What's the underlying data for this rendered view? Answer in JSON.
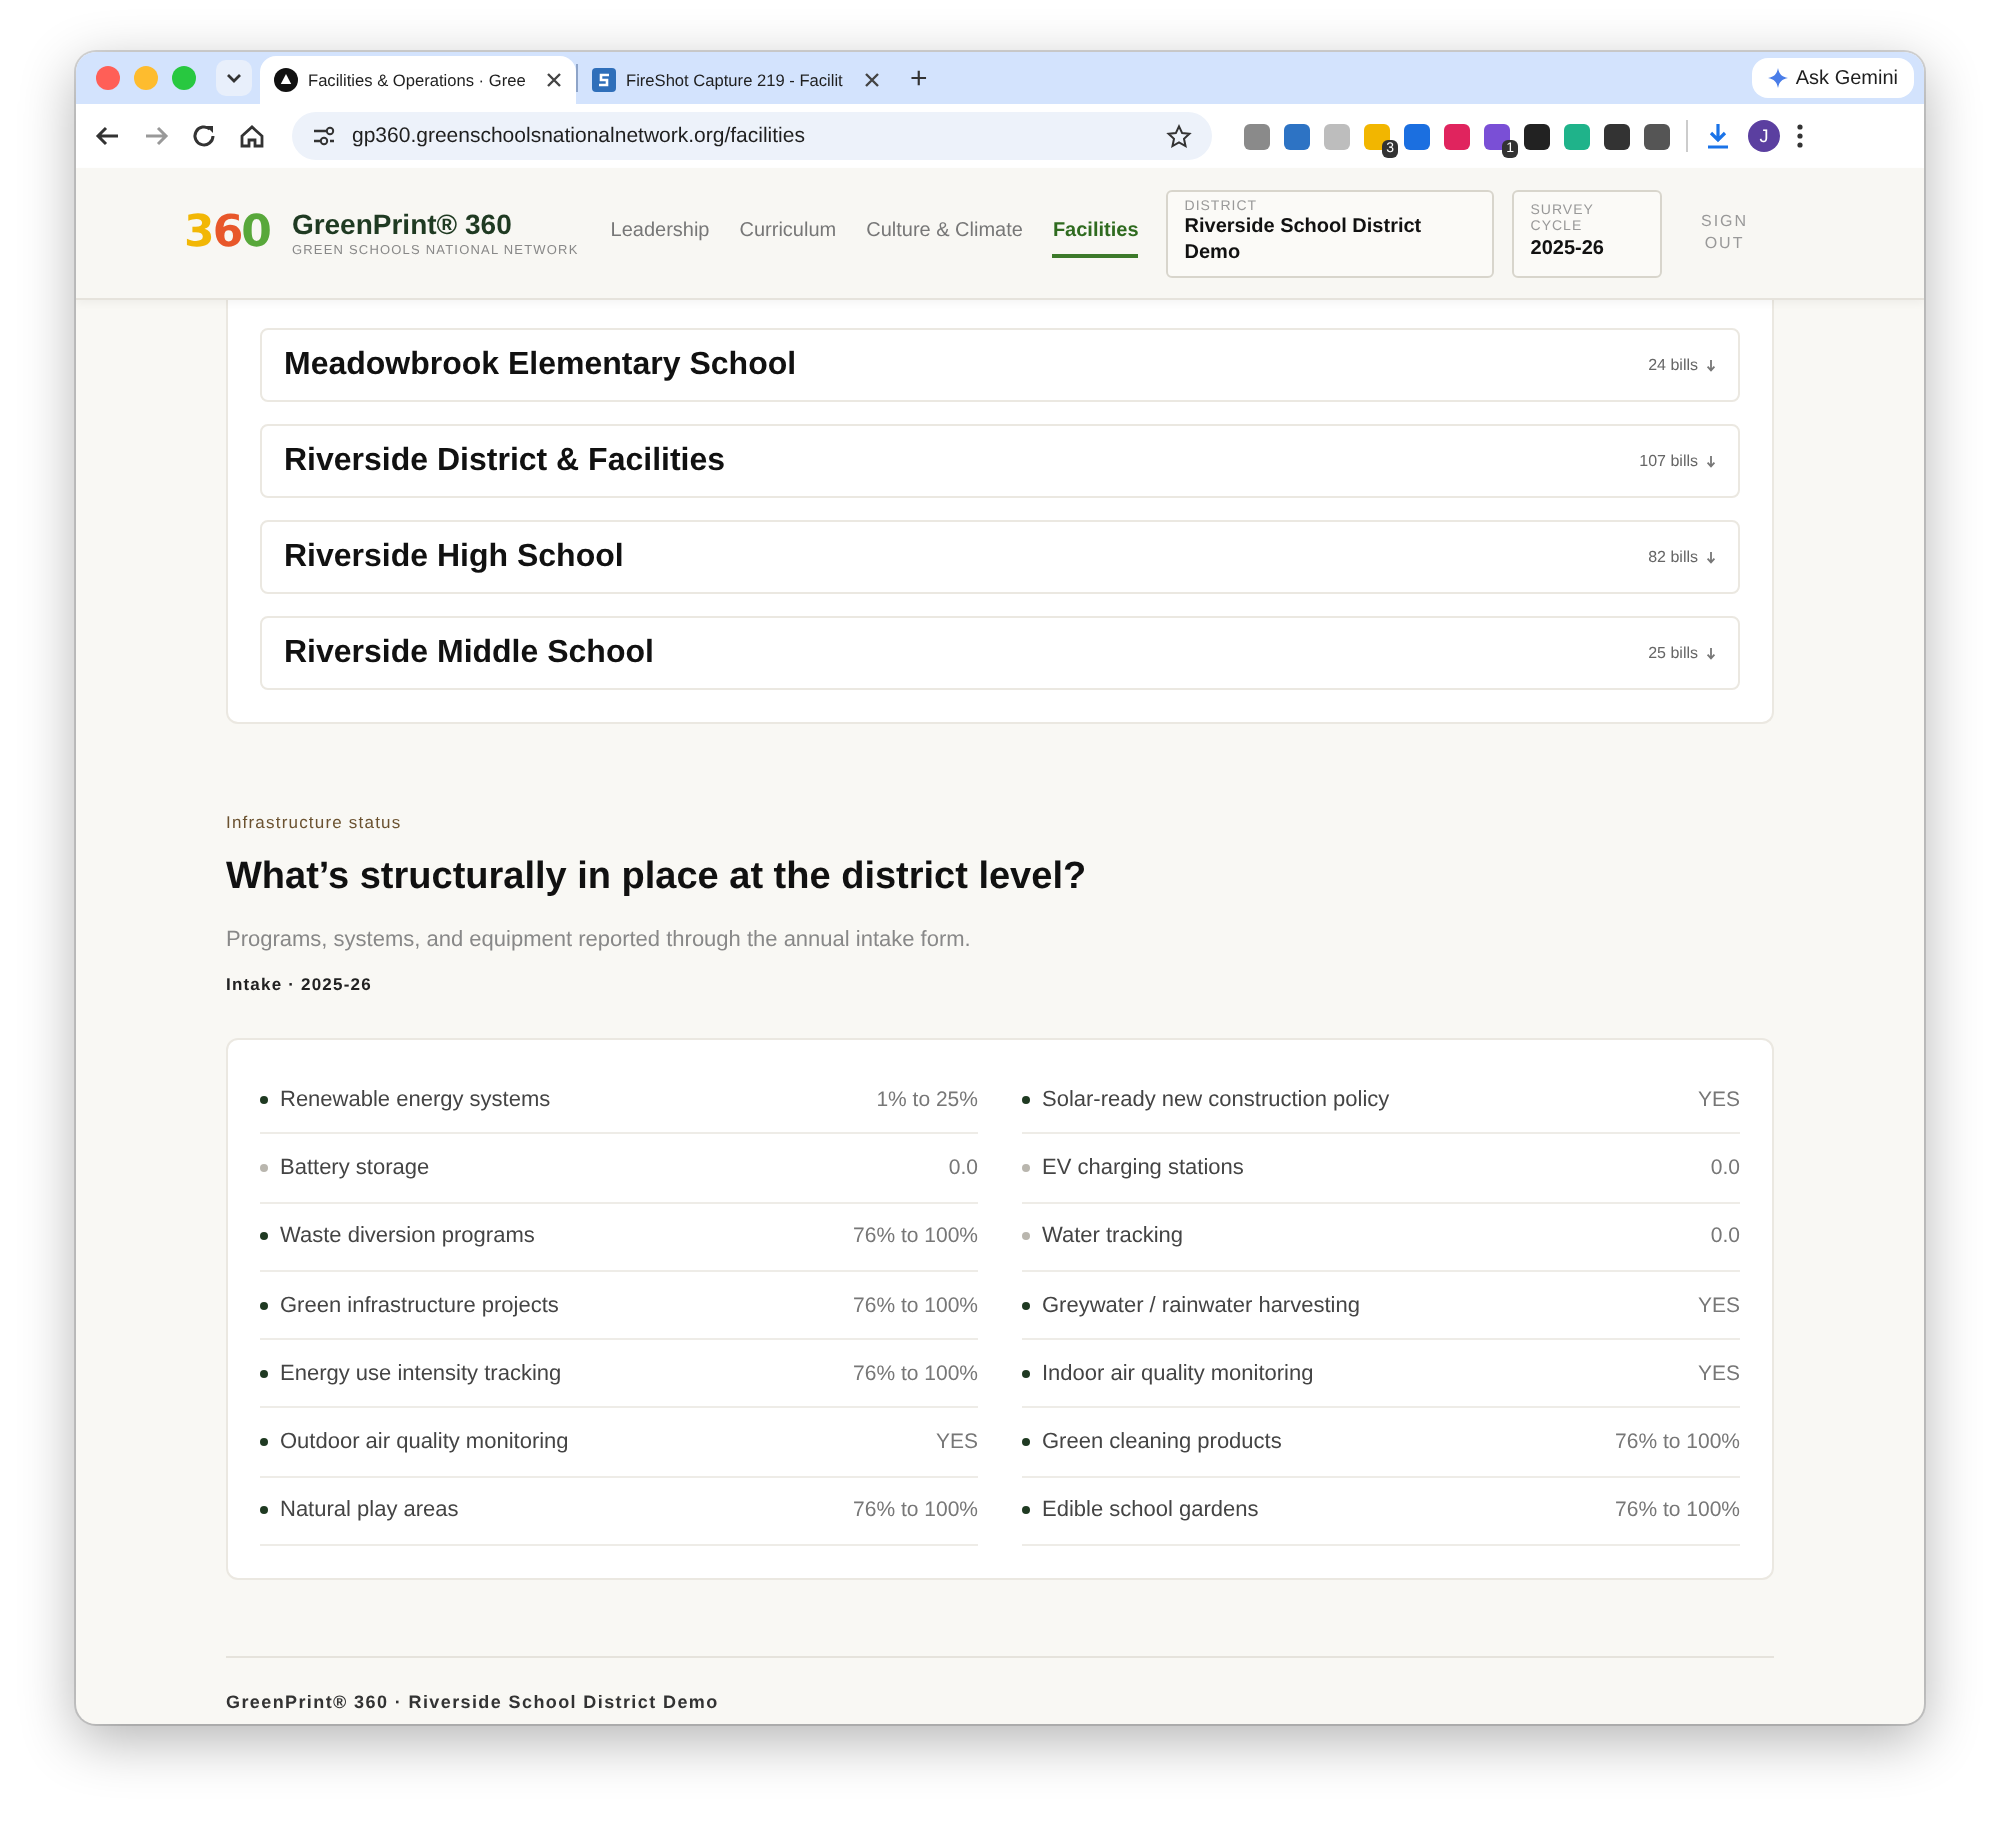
{
  "browser": {
    "tabs": [
      {
        "title": "Facilities & Operations · Gree",
        "selected": true
      },
      {
        "title": "FireShot Capture 219 - Facilit",
        "selected": false
      }
    ],
    "new_tab": "+",
    "url": "gp360.greenschoolsnationalnetwork.org/facilities",
    "ask_gemini": "Ask Gemini",
    "extension_badges": [
      "3",
      "1"
    ],
    "profile_initial": "J"
  },
  "header": {
    "logo_text": "360",
    "brand": "GreenPrint® 360",
    "tagline": "GREEN SCHOOLS NATIONAL NETWORK",
    "nav": [
      {
        "label": "Leadership",
        "selected": false
      },
      {
        "label": "Curriculum",
        "selected": false
      },
      {
        "label": "Culture & Climate",
        "selected": false
      },
      {
        "label": "Facilities",
        "selected": true
      }
    ],
    "district": {
      "label": "DISTRICT",
      "value": "Riverside School District Demo"
    },
    "cycle": {
      "label": "SURVEY CYCLE",
      "value": "2025-26"
    },
    "sign_out": "SIGN OUT"
  },
  "schools": [
    {
      "name": "Meadowbrook Elementary School",
      "bills": "24 bills"
    },
    {
      "name": "Riverside District & Facilities",
      "bills": "107 bills"
    },
    {
      "name": "Riverside High School",
      "bills": "82 bills"
    },
    {
      "name": "Riverside Middle School",
      "bills": "25 bills"
    }
  ],
  "infrastructure": {
    "eyebrow": "Infrastructure status",
    "title": "What’s structurally in place at the district level?",
    "subtitle": "Programs, systems, and equipment reported through the annual intake form.",
    "meta": "Intake · 2025-26",
    "columns": [
      {
        "items": [
          {
            "label": "Renewable energy systems",
            "value": "1% to 25%",
            "active": true
          },
          {
            "label": "Battery storage",
            "value": "0.0",
            "active": false
          },
          {
            "label": "Waste diversion programs",
            "value": "76% to 100%",
            "active": true
          },
          {
            "label": "Green infrastructure projects",
            "value": "76% to 100%",
            "active": true
          },
          {
            "label": "Energy use intensity tracking",
            "value": "76% to 100%",
            "active": true
          },
          {
            "label": "Outdoor air quality monitoring",
            "value": "YES",
            "active": true
          },
          {
            "label": "Natural play areas",
            "value": "76% to 100%",
            "active": true
          }
        ]
      },
      {
        "items": [
          {
            "label": "Solar-ready new construction policy",
            "value": "YES",
            "active": true
          },
          {
            "label": "EV charging stations",
            "value": "0.0",
            "active": false
          },
          {
            "label": "Water tracking",
            "value": "0.0",
            "active": false
          },
          {
            "label": "Greywater / rainwater harvesting",
            "value": "YES",
            "active": true
          },
          {
            "label": "Indoor air quality monitoring",
            "value": "YES",
            "active": true
          },
          {
            "label": "Green cleaning products",
            "value": "76% to 100%",
            "active": true
          },
          {
            "label": "Edible school gardens",
            "value": "76% to 100%",
            "active": true
          }
        ]
      }
    ]
  },
  "footer": "GreenPrint® 360 · Riverside School District Demo"
}
